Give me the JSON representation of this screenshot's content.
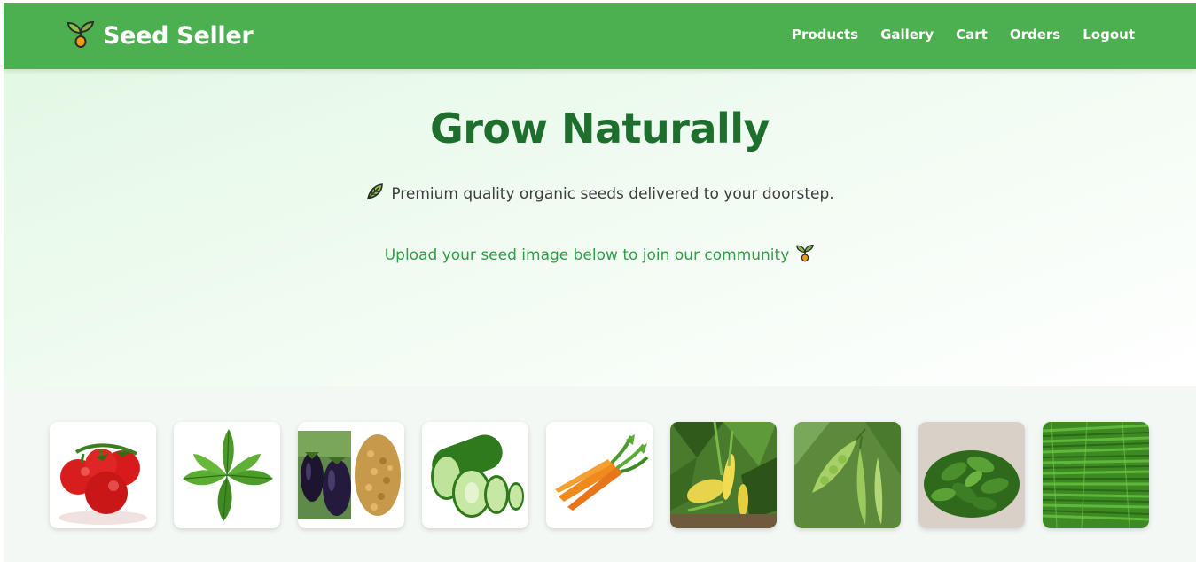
{
  "app": {
    "brand_name": "Seed Seller",
    "brand_icon": "seedling-icon"
  },
  "nav": {
    "items": [
      {
        "label": "Products"
      },
      {
        "label": "Gallery"
      },
      {
        "label": "Cart"
      },
      {
        "label": "Orders"
      },
      {
        "label": "Logout"
      }
    ]
  },
  "hero": {
    "title": "Grow Naturally",
    "subtitle_icon": "herb-leaf-icon",
    "subtitle": "Premium quality organic seeds delivered to your doorstep.",
    "cta": "Upload your seed image below to join our community",
    "cta_icon": "seedling-icon"
  },
  "gallery": {
    "items": [
      {
        "icon": "tomato-image"
      },
      {
        "icon": "basil-image"
      },
      {
        "icon": "eggplant-seeds-image"
      },
      {
        "icon": "cucumber-image"
      },
      {
        "icon": "carrot-image"
      },
      {
        "icon": "zucchini-plant-image"
      },
      {
        "icon": "pea-pods-image"
      },
      {
        "icon": "green-leaves-image"
      },
      {
        "icon": "green-beans-image"
      }
    ]
  },
  "colors": {
    "navbar": "#4caf50",
    "title": "#1e6f2e",
    "cta": "#2e9e45",
    "body_text": "#3d3d3d"
  }
}
